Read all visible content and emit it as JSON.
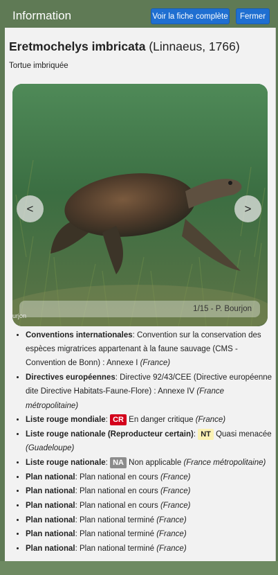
{
  "header": {
    "title": "Information",
    "full_sheet_label": "Voir la fiche complète",
    "close_label": "Fermer"
  },
  "species": {
    "scientific_name": "Eretmochelys imbricata",
    "authority": "(Linnaeus, 1766)",
    "common_name": "Tortue imbriquée"
  },
  "carousel": {
    "prev_label": "<",
    "next_label": ">",
    "caption": "1/15 - P. Bourjon",
    "watermark": "urjon",
    "position": 1,
    "total": 15
  },
  "statuses": [
    {
      "label": "Conventions internationales",
      "text": ": Convention sur la conservation des espèces migratrices appartenant à la faune sauvage (CMS - Convention de Bonn) : Annexe I ",
      "region": "(France)"
    },
    {
      "label": "Directives européennes",
      "text": ": Directive 92/43/CEE (Directive européenne dite Directive Habitats-Faune-Flore) : Annexe IV ",
      "region": "(France métropolitaine)"
    },
    {
      "label": "Liste rouge mondiale",
      "sep": ": ",
      "badge": "CR",
      "badge_color": "#d3001b",
      "text": " En danger critique ",
      "region": "(France)"
    },
    {
      "label": "Liste rouge nationale (Reproducteur certain)",
      "sep": ": ",
      "badge": "NT",
      "badge_color": "#fbf2b4",
      "text": " Quasi menacée ",
      "region": "(Guadeloupe)"
    },
    {
      "label": "Liste rouge nationale",
      "sep": ": ",
      "badge": "NA",
      "badge_color": "#8c8c8c",
      "text": " Non applicable ",
      "region": "(France métropolitaine)"
    },
    {
      "label": "Plan national",
      "text": ": Plan national en cours ",
      "region": "(France)"
    },
    {
      "label": "Plan national",
      "text": ": Plan national en cours ",
      "region": "(France)"
    },
    {
      "label": "Plan national",
      "text": ": Plan national en cours ",
      "region": "(France)"
    },
    {
      "label": "Plan national",
      "text": ": Plan national terminé ",
      "region": "(France)"
    },
    {
      "label": "Plan national",
      "text": ": Plan national terminé ",
      "region": "(France)"
    },
    {
      "label": "Plan national",
      "text": ": Plan national terminé ",
      "region": "(France)"
    }
  ],
  "colors": {
    "button": "#1f6fd1",
    "cr_badge": "#d3001b",
    "nt_badge": "#fbf2b4",
    "na_badge": "#8c8c8c"
  },
  "icons": {
    "prev": "chevron-left-icon",
    "next": "chevron-right-icon"
  }
}
